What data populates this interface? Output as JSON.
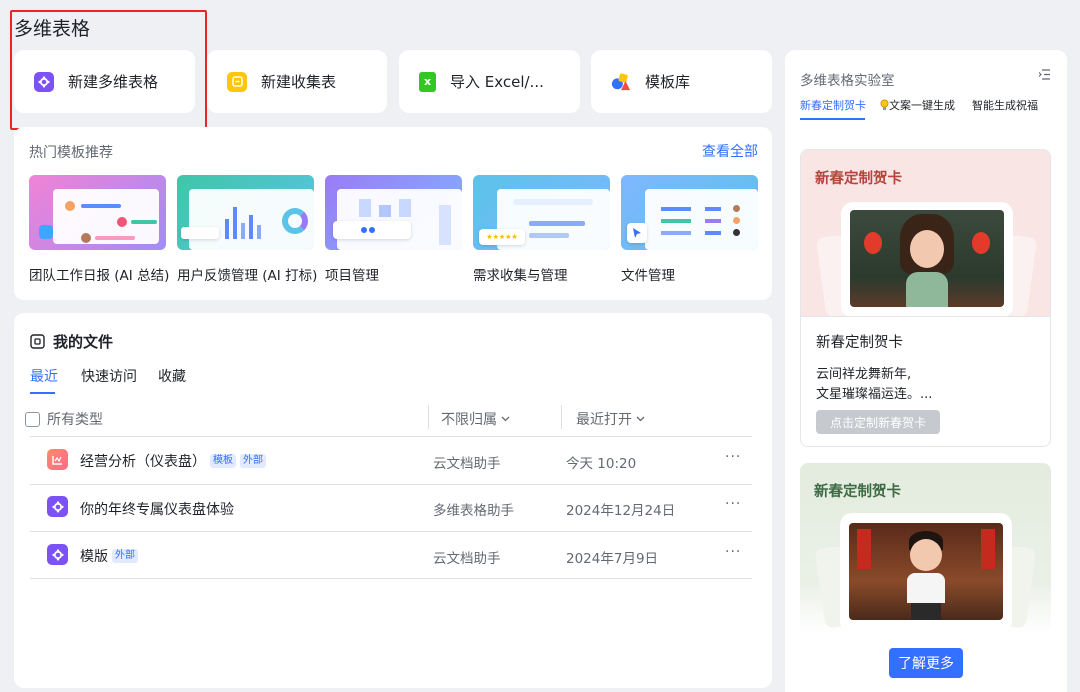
{
  "page_title": "多维表格",
  "quick_actions": [
    {
      "label": "新建多维表格",
      "icon": "bitable-icon",
      "color": "#7d52f4"
    },
    {
      "label": "新建收集表",
      "icon": "form-icon",
      "color": "#ffc60a"
    },
    {
      "label": "导入 Excel/...",
      "icon": "excel-icon",
      "color": "#34c724"
    },
    {
      "label": "模板库",
      "icon": "template-library-icon",
      "color": "#3370ff"
    }
  ],
  "hot_templates": {
    "title": "热门模板推荐",
    "see_all": "查看全部",
    "items": [
      {
        "label": "团队工作日报 (AI 总结)"
      },
      {
        "label": "用户反馈管理 (AI 打标)"
      },
      {
        "label": "项目管理"
      },
      {
        "label": "需求收集与管理"
      },
      {
        "label": "文件管理"
      }
    ]
  },
  "files": {
    "title": "我的文件",
    "tabs": [
      "最近",
      "快速访问",
      "收藏"
    ],
    "active_tab": "最近",
    "columns": {
      "type": "所有类型",
      "owner": "不限归属",
      "time": "最近打开"
    },
    "rows": [
      {
        "name": "经营分析（仪表盘）",
        "tags": [
          "模板",
          "外部"
        ],
        "owner": "云文档助手",
        "time": "今天 10:20",
        "icon": "dashboard-icon"
      },
      {
        "name": "你的年终专属仪表盘体验",
        "tags": [],
        "owner": "多维表格助手",
        "time": "2024年12月24日",
        "icon": "bitable-icon"
      },
      {
        "name": "模版",
        "tags": [
          "外部"
        ],
        "owner": "云文档助手",
        "time": "2024年7月9日",
        "icon": "bitable-icon"
      }
    ]
  },
  "lab": {
    "title": "多维表格实验室",
    "tabs": [
      "新春定制贺卡",
      "文案一键生成",
      "智能生成祝福"
    ],
    "active_tab": "新春定制贺卡",
    "cards": [
      {
        "header": "新春定制贺卡",
        "title": "新春定制贺卡",
        "body_line1": "云间祥龙舞新年,",
        "body_line2": "文星璀璨福运连。...",
        "button": "点击定制新春贺卡"
      },
      {
        "header": "新春定制贺卡"
      }
    ],
    "learn_more": "了解更多"
  },
  "colors": {
    "accent": "#3370ff",
    "highlight": "#e8262a"
  }
}
